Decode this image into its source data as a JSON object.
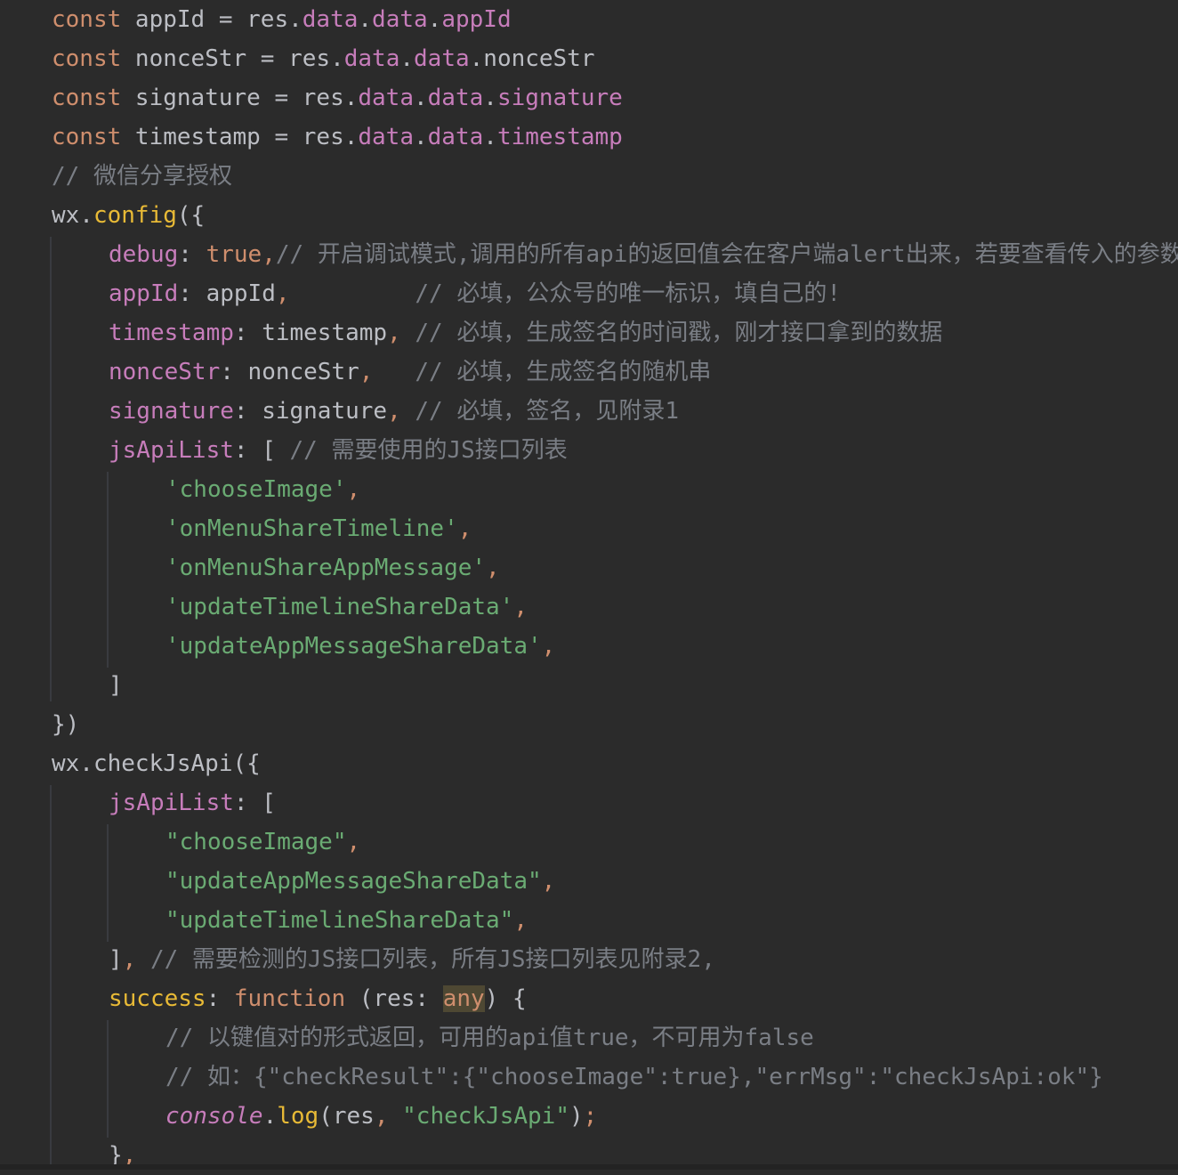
{
  "lines": [
    {
      "indent": 0,
      "tokens": [
        [
          "kw",
          "const "
        ],
        [
          "def",
          "appId = res."
        ],
        [
          "prop",
          "data"
        ],
        [
          "def",
          "."
        ],
        [
          "prop",
          "data"
        ],
        [
          "def",
          "."
        ],
        [
          "prop",
          "appId"
        ]
      ]
    },
    {
      "indent": 0,
      "tokens": [
        [
          "kw",
          "const "
        ],
        [
          "def",
          "nonceStr = res."
        ],
        [
          "prop",
          "data"
        ],
        [
          "def",
          "."
        ],
        [
          "prop",
          "data"
        ],
        [
          "def",
          ".nonceStr"
        ]
      ]
    },
    {
      "indent": 0,
      "tokens": [
        [
          "kw",
          "const "
        ],
        [
          "def",
          "signature = res."
        ],
        [
          "prop",
          "data"
        ],
        [
          "def",
          "."
        ],
        [
          "prop",
          "data"
        ],
        [
          "def",
          "."
        ],
        [
          "prop",
          "signature"
        ]
      ]
    },
    {
      "indent": 0,
      "tokens": [
        [
          "kw",
          "const "
        ],
        [
          "def",
          "timestamp = res."
        ],
        [
          "prop",
          "data"
        ],
        [
          "def",
          "."
        ],
        [
          "prop",
          "data"
        ],
        [
          "def",
          "."
        ],
        [
          "prop",
          "timestamp"
        ]
      ]
    },
    {
      "indent": 0,
      "tokens": [
        [
          "cmt",
          "// 微信分享授权"
        ]
      ]
    },
    {
      "indent": 0,
      "tokens": [
        [
          "def",
          "wx."
        ],
        [
          "yel",
          "config"
        ],
        [
          "def",
          "({"
        ]
      ]
    },
    {
      "indent": 1,
      "tokens": [
        [
          "prop",
          "debug"
        ],
        [
          "def",
          ": "
        ],
        [
          "kw",
          "true"
        ],
        [
          "comma",
          ","
        ],
        [
          "cmt",
          "// 开启调试模式,调用的所有api的返回值会在客户端alert出来，若要查看传入的参数"
        ]
      ]
    },
    {
      "indent": 1,
      "tokens": [
        [
          "prop",
          "appId"
        ],
        [
          "def",
          ": appId"
        ],
        [
          "comma",
          ","
        ],
        [
          "def",
          "         "
        ],
        [
          "cmt",
          "// 必填，公众号的唯一标识，填自己的!"
        ]
      ]
    },
    {
      "indent": 1,
      "tokens": [
        [
          "prop",
          "timestamp"
        ],
        [
          "def",
          ": timestamp"
        ],
        [
          "comma",
          ","
        ],
        [
          "def",
          " "
        ],
        [
          "cmt",
          "// 必填，生成签名的时间戳，刚才接口拿到的数据"
        ]
      ]
    },
    {
      "indent": 1,
      "tokens": [
        [
          "prop",
          "nonceStr"
        ],
        [
          "def",
          ": nonceStr"
        ],
        [
          "comma",
          ","
        ],
        [
          "def",
          "   "
        ],
        [
          "cmt",
          "// 必填，生成签名的随机串"
        ]
      ]
    },
    {
      "indent": 1,
      "tokens": [
        [
          "prop",
          "signature"
        ],
        [
          "def",
          ": signature"
        ],
        [
          "comma",
          ","
        ],
        [
          "def",
          " "
        ],
        [
          "cmt",
          "// 必填，签名，见附录1"
        ]
      ]
    },
    {
      "indent": 1,
      "tokens": [
        [
          "prop",
          "jsApiList"
        ],
        [
          "def",
          ": [ "
        ],
        [
          "cmt",
          "// 需要使用的JS接口列表"
        ]
      ]
    },
    {
      "indent": 2,
      "tokens": [
        [
          "str",
          "'chooseImage'"
        ],
        [
          "comma",
          ","
        ]
      ]
    },
    {
      "indent": 2,
      "tokens": [
        [
          "str",
          "'onMenuShareTimeline'"
        ],
        [
          "comma",
          ","
        ]
      ]
    },
    {
      "indent": 2,
      "tokens": [
        [
          "str",
          "'onMenuShareAppMessage'"
        ],
        [
          "comma",
          ","
        ]
      ]
    },
    {
      "indent": 2,
      "tokens": [
        [
          "str",
          "'updateTimelineShareData'"
        ],
        [
          "comma",
          ","
        ]
      ]
    },
    {
      "indent": 2,
      "tokens": [
        [
          "str",
          "'updateAppMessageShareData'"
        ],
        [
          "comma",
          ","
        ]
      ]
    },
    {
      "indent": 1,
      "tokens": [
        [
          "def",
          "]"
        ]
      ]
    },
    {
      "indent": 0,
      "tokens": [
        [
          "def",
          "})"
        ]
      ]
    },
    {
      "indent": 0,
      "tokens": [
        [
          "def",
          "wx.checkJsApi({"
        ]
      ]
    },
    {
      "indent": 1,
      "tokens": [
        [
          "prop",
          "jsApiList"
        ],
        [
          "def",
          ": ["
        ]
      ]
    },
    {
      "indent": 2,
      "tokens": [
        [
          "str",
          "\"chooseImage\""
        ],
        [
          "comma",
          ","
        ]
      ]
    },
    {
      "indent": 2,
      "tokens": [
        [
          "str",
          "\"updateAppMessageShareData\""
        ],
        [
          "comma",
          ","
        ]
      ]
    },
    {
      "indent": 2,
      "tokens": [
        [
          "str",
          "\"updateTimelineShareData\""
        ],
        [
          "comma",
          ","
        ]
      ]
    },
    {
      "indent": 1,
      "tokens": [
        [
          "def",
          "]"
        ],
        [
          "comma",
          ","
        ],
        [
          "def",
          " "
        ],
        [
          "cmt",
          "// 需要检测的JS接口列表，所有JS接口列表见附录2,"
        ]
      ]
    },
    {
      "indent": 1,
      "tokens": [
        [
          "yel",
          "success"
        ],
        [
          "def",
          ": "
        ],
        [
          "kw",
          "function "
        ],
        [
          "def",
          "(res: "
        ],
        [
          "hlkw",
          "any"
        ],
        [
          "def",
          ") {"
        ]
      ]
    },
    {
      "indent": 2,
      "tokens": [
        [
          "cmt",
          "// 以键值对的形式返回，可用的api值true，不可用为false"
        ]
      ]
    },
    {
      "indent": 2,
      "tokens": [
        [
          "cmt",
          "// 如：{\"checkResult\":{\"chooseImage\":true},\"errMsg\":\"checkJsApi:ok\"}"
        ]
      ]
    },
    {
      "indent": 2,
      "tokens": [
        [
          "italic",
          "console"
        ],
        [
          "def",
          "."
        ],
        [
          "yel",
          "log"
        ],
        [
          "def",
          "(res"
        ],
        [
          "comma",
          ","
        ],
        [
          "def",
          " "
        ],
        [
          "str",
          "\"checkJsApi\""
        ],
        [
          "def",
          ")"
        ],
        [
          "comma",
          ";"
        ]
      ]
    },
    {
      "indent": 1,
      "tokens": [
        [
          "def",
          "}"
        ],
        [
          "comma",
          ","
        ]
      ]
    }
  ]
}
